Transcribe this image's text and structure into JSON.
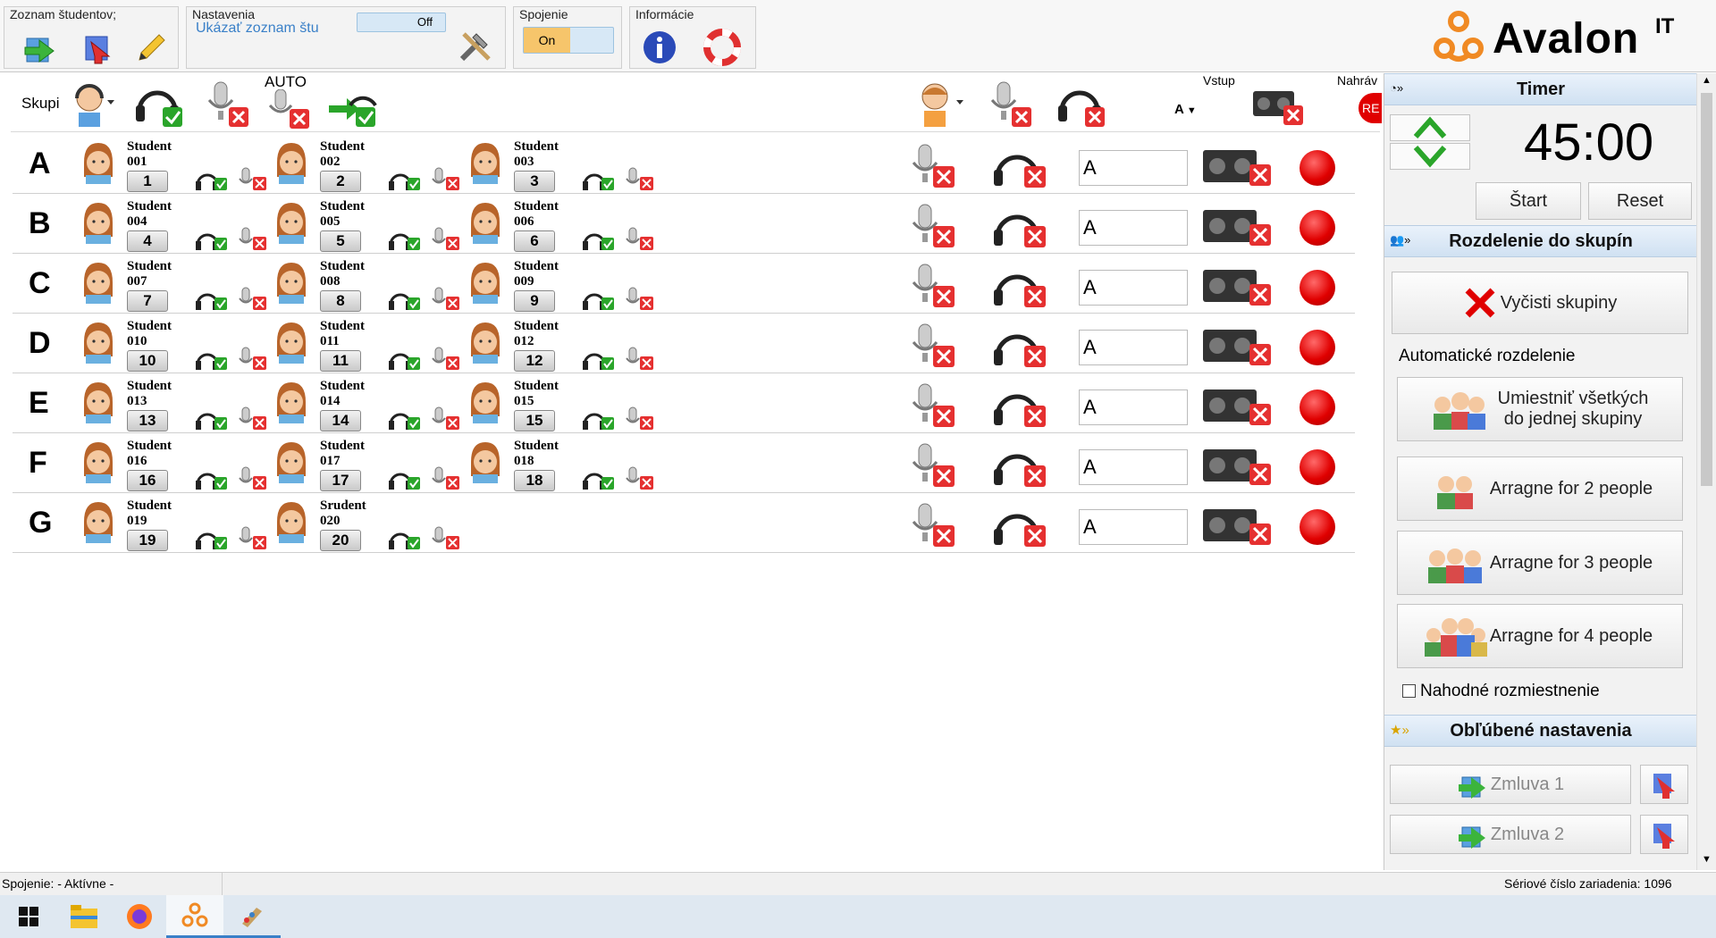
{
  "toolbar": {
    "students_group": "Zoznam študentov;",
    "settings_group": "Nastavenia",
    "settings_link": "Ukázať zoznam štu",
    "settings_toggle": "Off",
    "connection_group": "Spojenie",
    "connection_toggle": "On",
    "info_group": "Informácie",
    "brand": "Avalon",
    "brand_sup": "IT"
  },
  "header": {
    "groups_label": "Skupi",
    "auto_label": "AUTO",
    "input_label": "Vstup",
    "input_value": "A",
    "record_label": "Nahráv",
    "rec_badge": "RE"
  },
  "rows": [
    {
      "letter": "A",
      "students": [
        {
          "name": "Student\n001",
          "num": "1"
        },
        {
          "name": "Student\n002",
          "num": "2"
        },
        {
          "name": "Student\n003",
          "num": "3"
        }
      ],
      "input": "A"
    },
    {
      "letter": "B",
      "students": [
        {
          "name": "Student\n004",
          "num": "4"
        },
        {
          "name": "Student\n005",
          "num": "5"
        },
        {
          "name": "Student\n006",
          "num": "6"
        }
      ],
      "input": "A"
    },
    {
      "letter": "C",
      "students": [
        {
          "name": "Student\n007",
          "num": "7"
        },
        {
          "name": "Student\n008",
          "num": "8"
        },
        {
          "name": "Student\n009",
          "num": "9"
        }
      ],
      "input": "A"
    },
    {
      "letter": "D",
      "students": [
        {
          "name": "Student\n010",
          "num": "10"
        },
        {
          "name": "Student\n011",
          "num": "11"
        },
        {
          "name": "Student\n012",
          "num": "12"
        }
      ],
      "input": "A"
    },
    {
      "letter": "E",
      "students": [
        {
          "name": "Student\n013",
          "num": "13"
        },
        {
          "name": "Student\n014",
          "num": "14"
        },
        {
          "name": "Student\n015",
          "num": "15"
        }
      ],
      "input": "A"
    },
    {
      "letter": "F",
      "students": [
        {
          "name": "Student\n016",
          "num": "16"
        },
        {
          "name": "Student\n017",
          "num": "17"
        },
        {
          "name": "Student\n018",
          "num": "18"
        }
      ],
      "input": "A"
    },
    {
      "letter": "G",
      "students": [
        {
          "name": "Student\n019",
          "num": "19"
        },
        {
          "name": "Srudent\n020",
          "num": "20"
        }
      ],
      "input": "A"
    }
  ],
  "panel": {
    "timer_title": "Timer",
    "timer_value": "45:00",
    "start": "Štart",
    "reset": "Reset",
    "groups_title": "Rozdelenie do skupín",
    "clear_groups": "Vyčisti skupiny",
    "auto_title": "Automatické rozdelenie",
    "all_one_1": "Umiestniť všetkých",
    "all_one_2": "do jednej skupiny",
    "arr2": "Arragne for 2 people",
    "arr3": "Arragne for 3 people",
    "arr4": "Arragne for 4 people",
    "random": "Nahodné rozmiestnenie",
    "fav_title": "Obľúbené nastavenia",
    "fav1": "Zmluva 1",
    "fav2": "Zmluva 2"
  },
  "status": {
    "connection": "Spojenie: - Aktívne -",
    "serial": "Sériové číslo zariadenia: 1096"
  },
  "colors": {
    "accent": "#f6c56b",
    "brand": "#f08a24",
    "red": "#e00000",
    "green": "#2aa52a"
  }
}
